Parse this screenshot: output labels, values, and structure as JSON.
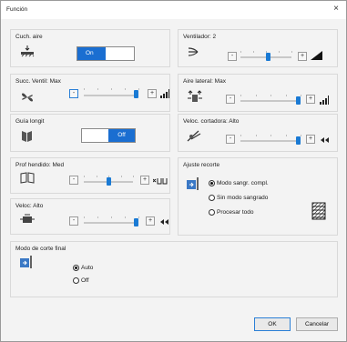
{
  "window": {
    "title": "Función",
    "close_glyph": "×"
  },
  "panels": {
    "air_cushion": {
      "title": "Cuch. aire",
      "toggle_value": "On",
      "icon": "air-cushion-icon"
    },
    "fan": {
      "title": "Ventilador: 2",
      "level": 0.55,
      "icon": "fan-blow-icon"
    },
    "suction_fan": {
      "title": "Succ. Ventil: Max",
      "level": 1.0,
      "icon": "suction-fan-icon"
    },
    "side_air": {
      "title": "Aire lateral: Max",
      "level": 1.0,
      "icon": "side-air-icon"
    },
    "long_guide": {
      "title": "Guía longit",
      "toggle_value": "Off",
      "icon": "long-guide-icon"
    },
    "cutter_speed": {
      "title": "Veloc. cortadora: Alto",
      "level": 1.0,
      "icon": "cutter-icon"
    },
    "split_depth": {
      "title": "Prof hendido: Med",
      "level": 0.5,
      "icon": "book-split-icon"
    },
    "trim_adjust": {
      "title": "Ajuste recorte",
      "icon": "trim-icon",
      "options": [
        "Modo sangr. compl.",
        "Sin modo sangrado",
        "Procesar todo"
      ],
      "selected_index": 0
    },
    "speed": {
      "title": "Veloc: Alto",
      "level": 1.0,
      "icon": "speed-motor-icon"
    },
    "final_cut": {
      "title": "Modo de corte final",
      "icon": "final-cut-icon",
      "options": [
        "Auto",
        "Off"
      ],
      "selected_index": 0
    }
  },
  "buttons": {
    "minus": "-",
    "plus": "+",
    "ok": "OK",
    "cancel": "Cancelar"
  },
  "colors": {
    "accent": "#1a6ed1",
    "border": "#d9d9d9",
    "panel_bg": "#f3f3f3"
  }
}
